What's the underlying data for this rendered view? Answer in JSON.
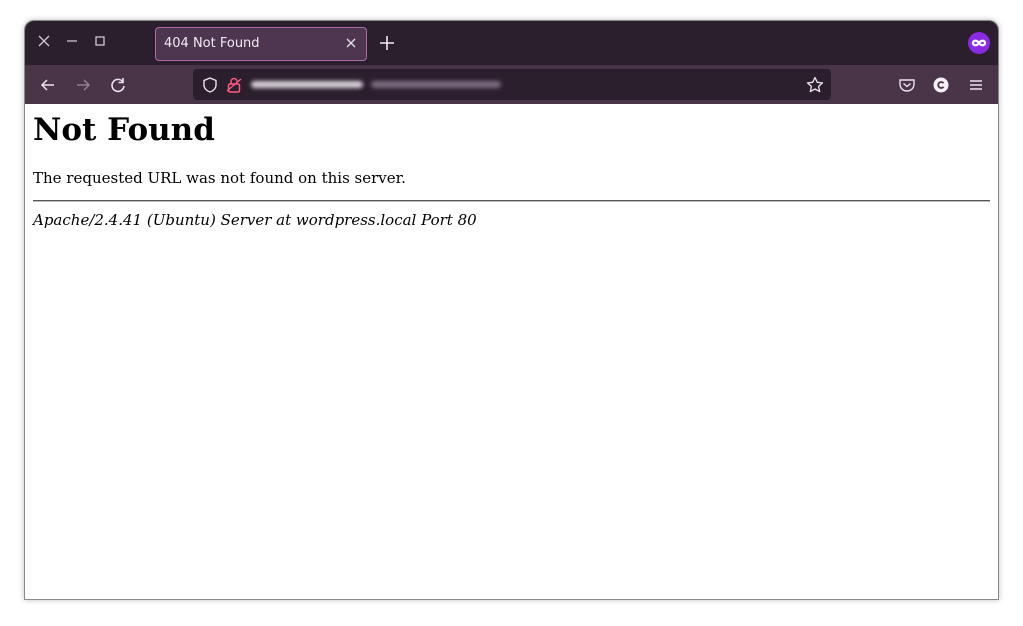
{
  "browser": {
    "tab": {
      "title": "404 Not Found"
    },
    "url_bar": {
      "host": "wordpress.local",
      "host_state": "blurred"
    },
    "colors": {
      "tabbar_bg": "#2b1e2d",
      "navbar_bg": "#4a3447",
      "active_tab_bg": "#4e3650",
      "active_tab_border": "#b06aa8",
      "extension_accent": "#8a2be2"
    },
    "icons": {
      "window_close": "close-icon",
      "window_minimize": "minimize-icon",
      "window_maximize": "maximize-icon",
      "tab_close": "close-icon",
      "new_tab": "plus-icon",
      "extension": "infinity-icon",
      "back": "arrow-left-icon",
      "forward": "arrow-right-icon",
      "reload": "reload-icon",
      "tracking_protection": "shield-icon",
      "insecure_connection": "broken-lock-icon",
      "bookmark": "star-icon",
      "pocket": "pocket-icon",
      "account": "account-icon",
      "menu": "hamburger-menu-icon"
    }
  },
  "page": {
    "heading": "Not Found",
    "message": "The requested URL was not found on this server.",
    "server_signature": "Apache/2.4.41 (Ubuntu) Server at wordpress.local Port 80"
  }
}
